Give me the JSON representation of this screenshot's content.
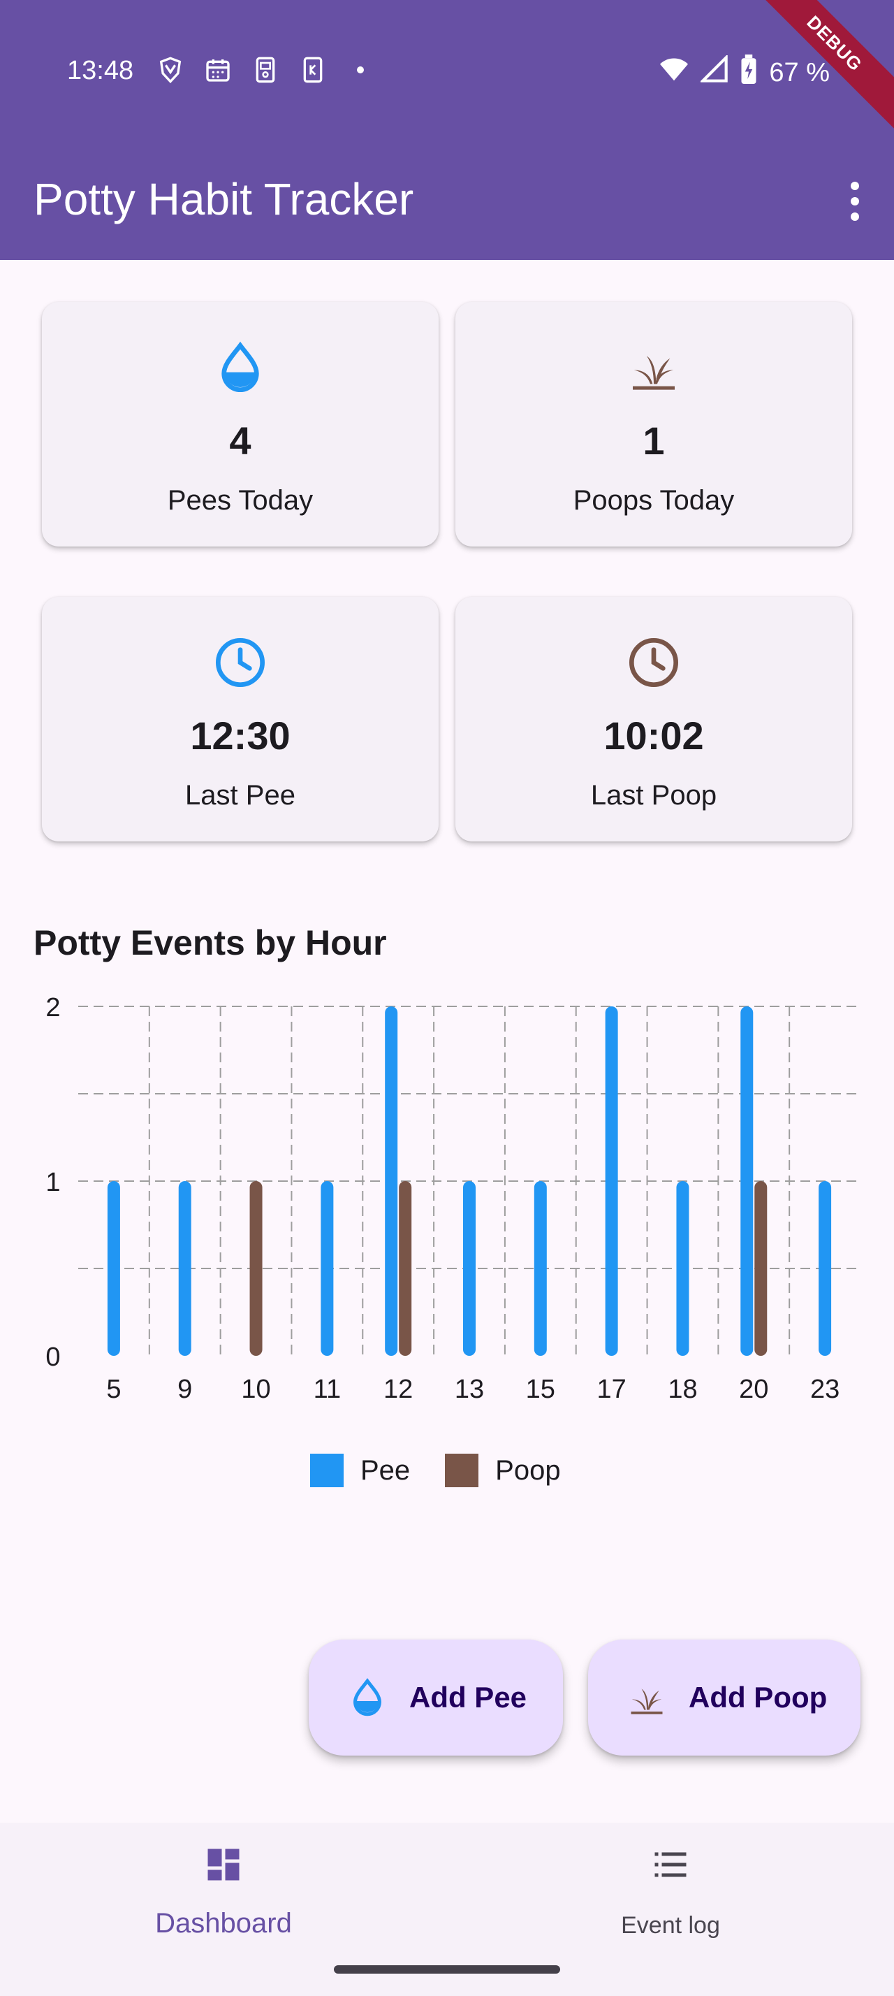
{
  "status_bar": {
    "time": "13:48",
    "battery": "67 %",
    "debug_label": "DEBUG"
  },
  "app_bar": {
    "title": "Potty Habit Tracker"
  },
  "colors": {
    "primary": "#6750a4",
    "pee": "#2196f3",
    "poop": "#795548",
    "fab_bg": "#eaddff"
  },
  "stats": [
    {
      "icon": "water-drop-icon",
      "value": "4",
      "label": "Pees Today"
    },
    {
      "icon": "grass-icon",
      "value": "1",
      "label": "Poops Today"
    },
    {
      "icon": "clock-icon",
      "value": "12:30",
      "label": "Last Pee"
    },
    {
      "icon": "clock-icon",
      "value": "10:02",
      "label": "Last Poop"
    }
  ],
  "chart_title": "Potty Events by Hour",
  "chart_data": {
    "type": "bar",
    "categories": [
      "5",
      "9",
      "10",
      "11",
      "12",
      "13",
      "15",
      "17",
      "18",
      "20",
      "23"
    ],
    "series": [
      {
        "name": "Pee",
        "values": [
          1,
          1,
          0,
          1,
          2,
          1,
          1,
          2,
          1,
          2,
          1
        ]
      },
      {
        "name": "Poop",
        "values": [
          0,
          0,
          1,
          0,
          1,
          0,
          0,
          0,
          0,
          1,
          0
        ]
      }
    ],
    "ylim": [
      0,
      2
    ],
    "yticks": [
      "0",
      "1",
      "2"
    ],
    "grid": true,
    "legend_position": "bottom"
  },
  "actions": {
    "add_pee": "Add Pee",
    "add_poop": "Add Poop"
  },
  "nav": {
    "dashboard": "Dashboard",
    "event_log": "Event log"
  }
}
